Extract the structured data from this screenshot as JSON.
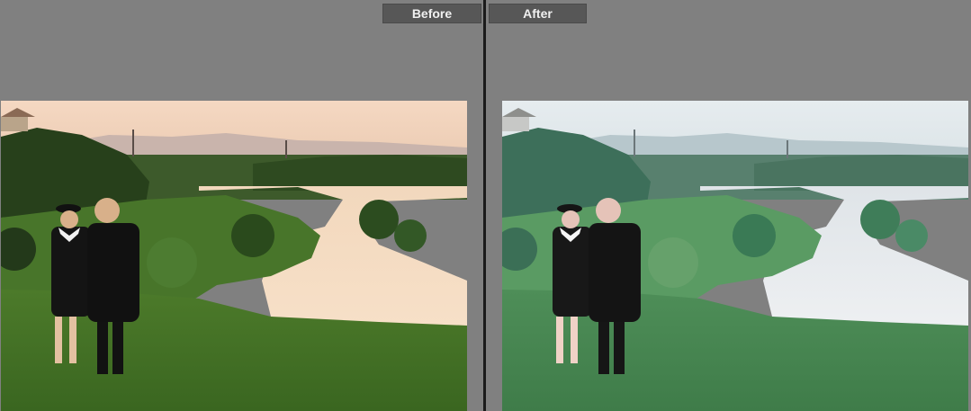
{
  "compare_view": {
    "before_label": "Before",
    "after_label": "After"
  },
  "colors": {
    "background": "#808080",
    "label_bg": "#575757",
    "divider": "#1a1a1a"
  }
}
